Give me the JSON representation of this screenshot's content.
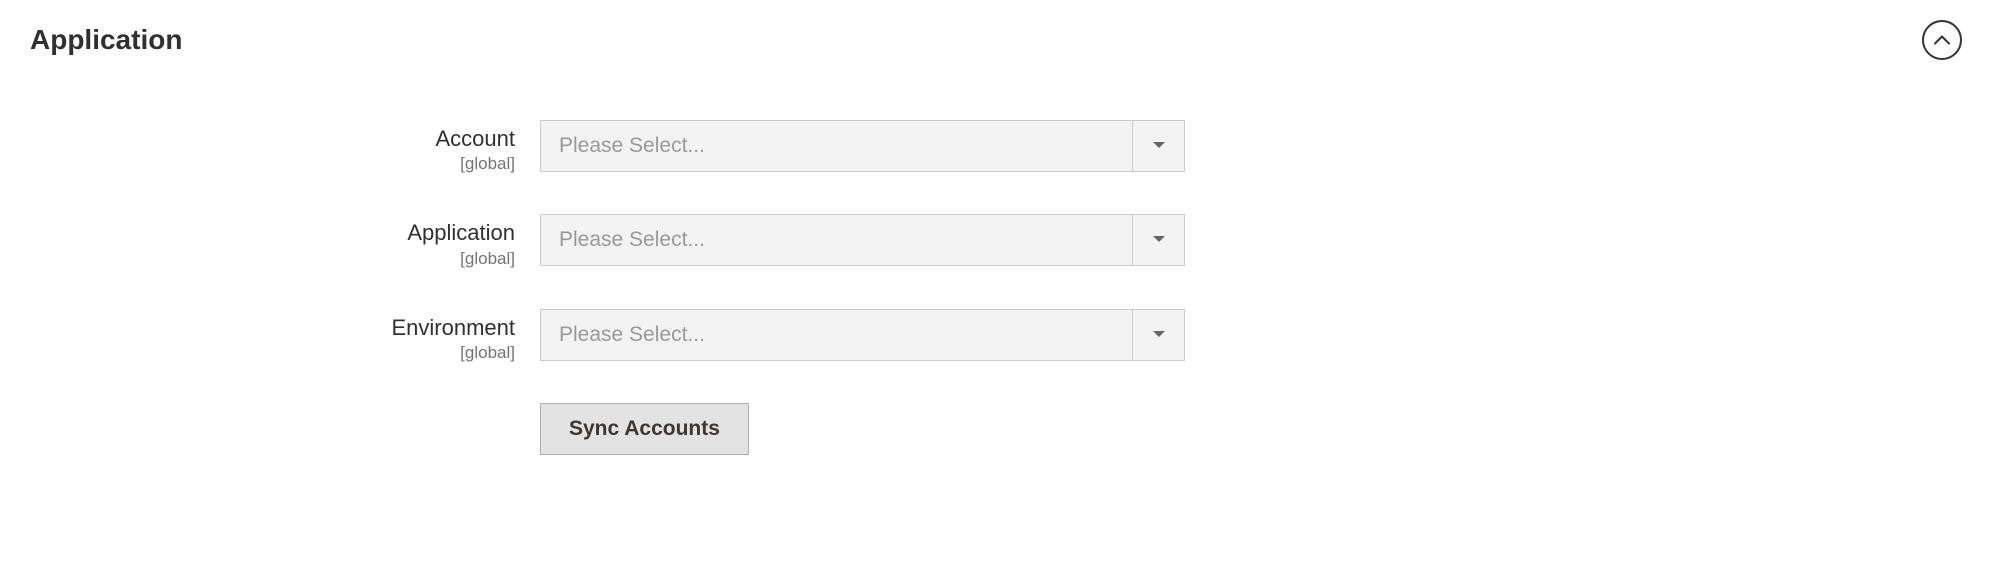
{
  "section": {
    "title": "Application"
  },
  "fields": {
    "account": {
      "label": "Account",
      "scope": "[global]",
      "placeholder": "Please Select..."
    },
    "application": {
      "label": "Application",
      "scope": "[global]",
      "placeholder": "Please Select..."
    },
    "environment": {
      "label": "Environment",
      "scope": "[global]",
      "placeholder": "Please Select..."
    }
  },
  "actions": {
    "sync_label": "Sync Accounts"
  }
}
